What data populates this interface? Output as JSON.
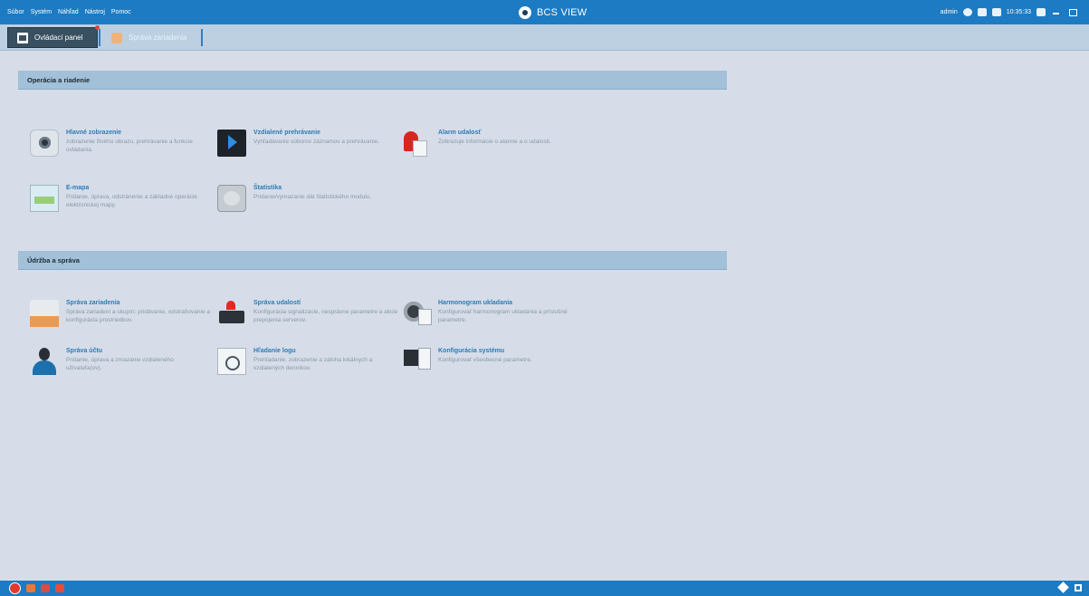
{
  "titlebar": {
    "menu": [
      "Súbor",
      "Systém",
      "Náhľad",
      "Nástroj",
      "Pomoc"
    ],
    "app_title": "BCS VIEW",
    "user": "admin",
    "time": "10:35:33"
  },
  "tabs": [
    {
      "label": "Ovládací panel",
      "active": true
    },
    {
      "label": "Správa zariadenia",
      "active": false
    }
  ],
  "sections": [
    {
      "title": "Operácia a riadenie",
      "items": [
        {
          "title": "Hlavné zobrazenie",
          "description": "zobrazenie živého obrazu, prehrávanie a funkcie ovládania.",
          "icon": "camera-icon"
        },
        {
          "title": "Vzdialené prehrávanie",
          "description": "Vyhľadávanie súborov záznamov a prehrávanie.",
          "icon": "playback-icon"
        },
        {
          "title": "Alarm udalosť",
          "description": "Zobrazuje informácie o alarme a o udalosti.",
          "icon": "alarm-icon"
        },
        {
          "title": "E-mapa",
          "description": "Pridanie, úprava, odstránenie a základné operácie elektronickej mapy.",
          "icon": "emap-icon"
        },
        {
          "title": "Štatistika",
          "description": "Pridanie/vymazanie dát štatistického modulu.",
          "icon": "statistics-icon"
        }
      ]
    },
    {
      "title": "Údržba a správa",
      "items": [
        {
          "title": "Správa zariadenia",
          "description": "Správa zariadení a skupín: pridávanie, odstraňovanie a konfigurácia prostriedkov.",
          "icon": "device-management-icon"
        },
        {
          "title": "Správa udalostí",
          "description": "Konfigurácia signalizácie, nesprávne parametre a akcie prepojenia serverov.",
          "icon": "event-management-icon"
        },
        {
          "title": "Harmonogram ukladania",
          "description": "Konfigurovať harmonogram ukladania a príslušné parametre.",
          "icon": "storage-schedule-icon"
        },
        {
          "title": "Správa účtu",
          "description": "Pridanie, úprava a zmazanie vzdialeného užívateľa(ov).",
          "icon": "user-account-icon"
        },
        {
          "title": "Hľadanie logu",
          "description": "Prehľadanie, zobrazenie a záloha lokálnych a vzdialených denníkov.",
          "icon": "log-search-icon"
        },
        {
          "title": "Konfigurácia systému",
          "description": "Konfigurovať všeobecné parametre.",
          "icon": "system-config-icon"
        }
      ]
    }
  ]
}
